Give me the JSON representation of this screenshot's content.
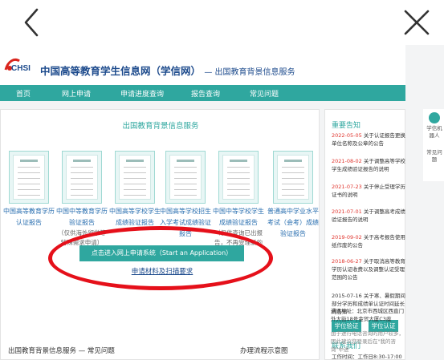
{
  "browser": {
    "back_icon": "chevron-left-icon",
    "close_icon": "close-icon"
  },
  "site": {
    "logo_text": "CHSI",
    "title": "中国高等教育学生信息网（学信网）",
    "subtitle": "— 出国教育背景信息服务"
  },
  "nav": {
    "items": [
      {
        "label": "首页"
      },
      {
        "label": "网上申请"
      },
      {
        "label": "申请进度查询"
      },
      {
        "label": "报告查询"
      },
      {
        "label": "常见问题"
      }
    ]
  },
  "main": {
    "title": "出国教育背景信息服务",
    "services": [
      {
        "label": "中国高等教育学历认证报告",
        "note": ""
      },
      {
        "label": "中国中等教育学历验证报告",
        "note": "（仅供海外留学等特殊需求申请）"
      },
      {
        "label": "中国高等学校学生成绩验证报告",
        "note": ""
      },
      {
        "label": "中国高等学校招生入学考试成绩验证报告",
        "note": ""
      },
      {
        "label": "中国中等学校学生成绩验证报告",
        "note": "（仅供查询已出报告，不再受理新的申请）"
      },
      {
        "label": "普通高中学业水平考试（会考）成绩验证报告",
        "note": ""
      }
    ],
    "apply_button": "点击进入网上申请系统（Start an Application）",
    "materials_link": "申请材料及扫描要求"
  },
  "sidebar": {
    "notices_title": "重要告知",
    "notices": [
      {
        "date": "2022-05-05",
        "text": "关于认证报告更换单位名称及公章的公告",
        "highlight": true
      },
      {
        "date": "2021-08-02",
        "text": "关于调整高等学校学生成绩验证报告的说明",
        "highlight": true
      },
      {
        "date": "2021-07-23",
        "text": "关于停止受理学历证书的说明",
        "highlight": true
      },
      {
        "date": "2021-07-01",
        "text": "关于调整高考成绩验证报告的说明",
        "highlight": true
      },
      {
        "date": "2019-09-02",
        "text": "关于高考报告使用纸作废的公告",
        "highlight": true
      },
      {
        "date": "2018-06-27",
        "text": "关于取消高等教育学历认证收费以及调整认证受理范围的公告",
        "highlight": true
      },
      {
        "date": "2015-07-16",
        "text": "关于寒、暑假期间部分学历和成绩单认证时间延长的告知",
        "highlight": false
      }
    ],
    "buttons": [
      {
        "label": "学位验证"
      },
      {
        "label": "学位认证"
      }
    ],
    "contact_title": "联系我们",
    "contact": [
      "工作时间：工作日8:30-17:00",
      "通讯地址：北京市西城区西直门外大街18号金贸大厦C3座",
      "由于进行电话咨询的用户较多，因此建议您登录后在\"我的咨询\"中进"
    ]
  },
  "bottom": {
    "faq_title": "出国教育背景信息服务 — 常见问题",
    "process_title": "办理流程示意图"
  },
  "float_panel": {
    "items": [
      {
        "label": "学信机器人"
      },
      {
        "label": "常见问题"
      }
    ]
  },
  "colors": {
    "brand": "#2fa79f",
    "accent_red": "#e5101a",
    "link": "#1c4a8c"
  }
}
